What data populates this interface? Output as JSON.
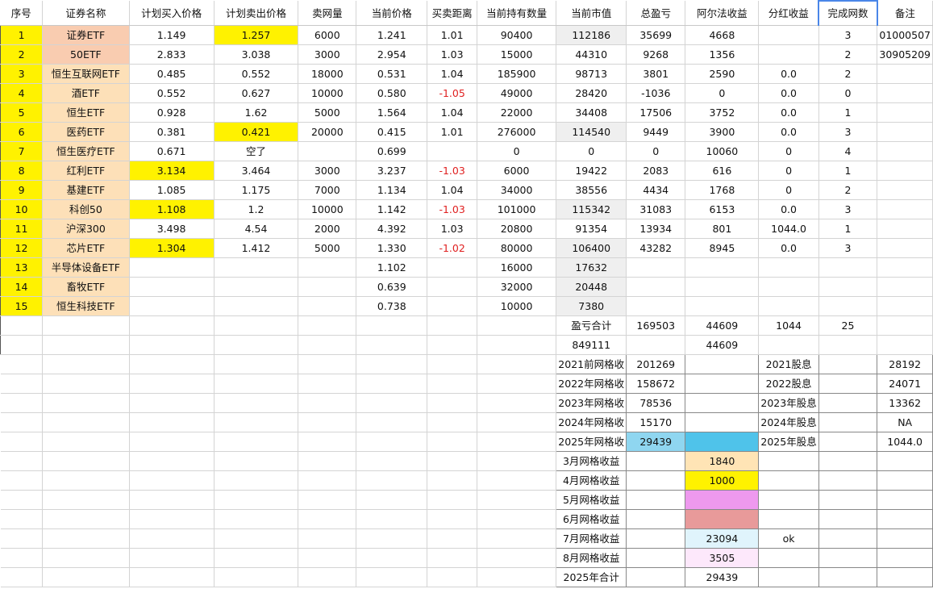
{
  "colors": {
    "idx_fill": "#fff200",
    "name_fill": "#fde0b8",
    "name_fill_strong": "#f9ccb0",
    "yellow": "#fff200",
    "gray": "#efefef",
    "blue": "#4fc3ea",
    "blue_light": "#8fd6f0",
    "peach": "#ffe4b5",
    "violet": "#ee99ee",
    "rose": "#e89a9a",
    "ice": "#e0f4fc",
    "pink": "#fde8fb",
    "negative_text": "#e02020"
  },
  "sheet": {
    "headers": [
      "序号",
      "证券名称",
      "计划买入价格",
      "计划卖出价格",
      "卖网量",
      "当前价格",
      "买卖距离",
      "当前持有数量",
      "当前市值",
      "总盈亏",
      "阿尔法收益",
      "分红收益",
      "完成网数",
      "备注"
    ],
    "rows": [
      [
        "1",
        "证券ETF",
        "1.149",
        "1.257",
        "6000",
        "1.241",
        "1.01",
        "90400",
        "112186",
        "35699",
        "4668",
        "",
        "3",
        "01000507"
      ],
      [
        "2",
        "50ETF",
        "2.833",
        "3.038",
        "3000",
        "2.954",
        "1.03",
        "15000",
        "44310",
        "9268",
        "1356",
        "",
        "2",
        "30905209"
      ],
      [
        "3",
        "恒生互联网ETF",
        "0.485",
        "0.552",
        "18000",
        "0.531",
        "1.04",
        "185900",
        "98713",
        "3801",
        "2590",
        "0.0",
        "2",
        ""
      ],
      [
        "4",
        "酒ETF",
        "0.552",
        "0.627",
        "10000",
        "0.580",
        "-1.05",
        "49000",
        "28420",
        "-1036",
        "0",
        "0.0",
        "0",
        ""
      ],
      [
        "5",
        "恒生ETF",
        "0.928",
        "1.62",
        "5000",
        "1.564",
        "1.04",
        "22000",
        "34408",
        "17506",
        "3752",
        "0.0",
        "1",
        ""
      ],
      [
        "6",
        "医药ETF",
        "0.381",
        "0.421",
        "20000",
        "0.415",
        "1.01",
        "276000",
        "114540",
        "9449",
        "3900",
        "0.0",
        "3",
        ""
      ],
      [
        "7",
        "恒生医疗ETF",
        "0.671",
        "空了",
        "",
        "0.699",
        "",
        "0",
        "0",
        "0",
        "10060",
        "0",
        "4",
        ""
      ],
      [
        "8",
        "红利ETF",
        "3.134",
        "3.464",
        "3000",
        "3.237",
        "-1.03",
        "6000",
        "19422",
        "2083",
        "616",
        "0",
        "1",
        ""
      ],
      [
        "9",
        "基建ETF",
        "1.085",
        "1.175",
        "7000",
        "1.134",
        "1.04",
        "34000",
        "38556",
        "4434",
        "1768",
        "0",
        "2",
        ""
      ],
      [
        "10",
        "科创50",
        "1.108",
        "1.2",
        "10000",
        "1.142",
        "-1.03",
        "101000",
        "115342",
        "31083",
        "6153",
        "0.0",
        "3",
        ""
      ],
      [
        "11",
        "沪深300",
        "3.498",
        "4.54",
        "2000",
        "4.392",
        "1.03",
        "20800",
        "91354",
        "13934",
        "801",
        "1044.0",
        "1",
        ""
      ],
      [
        "12",
        "芯片ETF",
        "1.304",
        "1.412",
        "5000",
        "1.330",
        "-1.02",
        "80000",
        "106400",
        "43282",
        "8945",
        "0.0",
        "3",
        ""
      ],
      [
        "13",
        "半导体设备ETF",
        "",
        "",
        "",
        "1.102",
        "",
        "16000",
        "17632",
        "",
        "",
        "",
        "",
        ""
      ],
      [
        "14",
        "畜牧ETF",
        "",
        "",
        "",
        "0.639",
        "",
        "32000",
        "20448",
        "",
        "",
        "",
        "",
        ""
      ],
      [
        "15",
        "恒生科技ETF",
        "",
        "",
        "",
        "0.738",
        "",
        "10000",
        "7380",
        "",
        "",
        "",
        "",
        ""
      ],
      [
        "",
        "",
        "",
        "",
        "",
        "",
        "",
        "",
        "盈亏合计",
        "169503",
        "44609",
        "1044",
        "25",
        ""
      ],
      [
        "",
        "",
        "",
        "",
        "",
        "",
        "",
        "",
        "849111",
        "",
        "44609",
        "",
        "",
        ""
      ],
      [
        "",
        "",
        "",
        "",
        "",
        "",
        "",
        "",
        "2021前网格收",
        "201269",
        "",
        "2021股息",
        "",
        "28192"
      ],
      [
        "",
        "",
        "",
        "",
        "",
        "",
        "",
        "",
        "2022年网格收",
        "158672",
        "",
        "2022股息",
        "",
        "24071"
      ],
      [
        "",
        "",
        "",
        "",
        "",
        "",
        "",
        "",
        "2023年网格收",
        "78536",
        "",
        "2023年股息",
        "",
        "13362"
      ],
      [
        "",
        "",
        "",
        "",
        "",
        "",
        "",
        "",
        "2024年网格收",
        "15170",
        "",
        "2024年股息",
        "",
        "NA"
      ],
      [
        "",
        "",
        "",
        "",
        "",
        "",
        "",
        "",
        "2025年网格收",
        "29439",
        "",
        "2025年股息",
        "",
        "1044.0"
      ],
      [
        "",
        "",
        "",
        "",
        "",
        "",
        "",
        "",
        "3月网格收益",
        "",
        "1840",
        "",
        "",
        ""
      ],
      [
        "",
        "",
        "",
        "",
        "",
        "",
        "",
        "",
        "4月网格收益",
        "",
        "1000",
        "",
        "",
        ""
      ],
      [
        "",
        "",
        "",
        "",
        "",
        "",
        "",
        "",
        "5月网格收益",
        "",
        "",
        "",
        "",
        ""
      ],
      [
        "",
        "",
        "",
        "",
        "",
        "",
        "",
        "",
        "6月网格收益",
        "",
        "",
        "",
        "",
        ""
      ],
      [
        "",
        "",
        "",
        "",
        "",
        "",
        "",
        "",
        "7月网格收益",
        "",
        "23094",
        "ok",
        "",
        ""
      ],
      [
        "",
        "",
        "",
        "",
        "",
        "",
        "",
        "",
        "8月网格收益",
        "",
        "3505",
        "",
        "",
        ""
      ],
      [
        "",
        "",
        "",
        "",
        "",
        "",
        "",
        "",
        "2025年合计",
        "",
        "29439",
        "",
        "",
        ""
      ]
    ]
  }
}
